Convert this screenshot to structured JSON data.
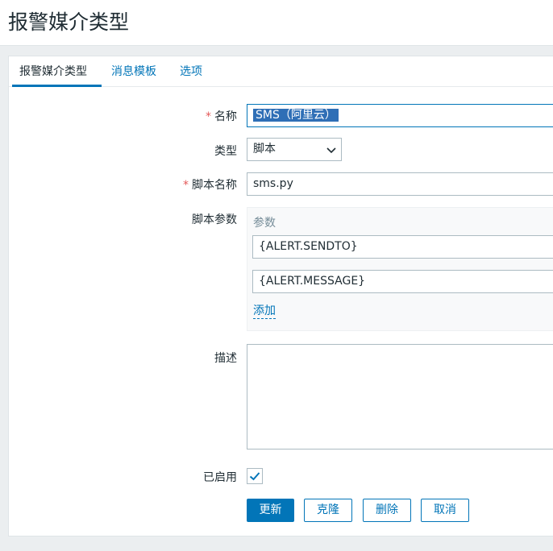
{
  "page": {
    "title": "报警媒介类型"
  },
  "tabs": [
    {
      "label": "报警媒介类型",
      "active": true
    },
    {
      "label": "消息模板",
      "active": false
    },
    {
      "label": "选项",
      "active": false
    }
  ],
  "form": {
    "name": {
      "label": "名称",
      "value": "SMS（阿里云）",
      "required": true
    },
    "type": {
      "label": "类型",
      "value": "脚本"
    },
    "script_name": {
      "label": "脚本名称",
      "value": "sms.py",
      "required": true
    },
    "script_params": {
      "label": "脚本参数",
      "header": "参数",
      "items": [
        "{ALERT.SENDTO}",
        "{ALERT.MESSAGE}"
      ],
      "add_label": "添加"
    },
    "description": {
      "label": "描述",
      "value": ""
    },
    "enabled": {
      "label": "已启用",
      "checked": true
    },
    "required_mark": "*"
  },
  "buttons": {
    "update": "更新",
    "clone": "克隆",
    "delete": "删除",
    "cancel": "取消"
  },
  "colors": {
    "accent": "#0275b8",
    "required": "#e45959",
    "selection": "#2f6fb6"
  }
}
